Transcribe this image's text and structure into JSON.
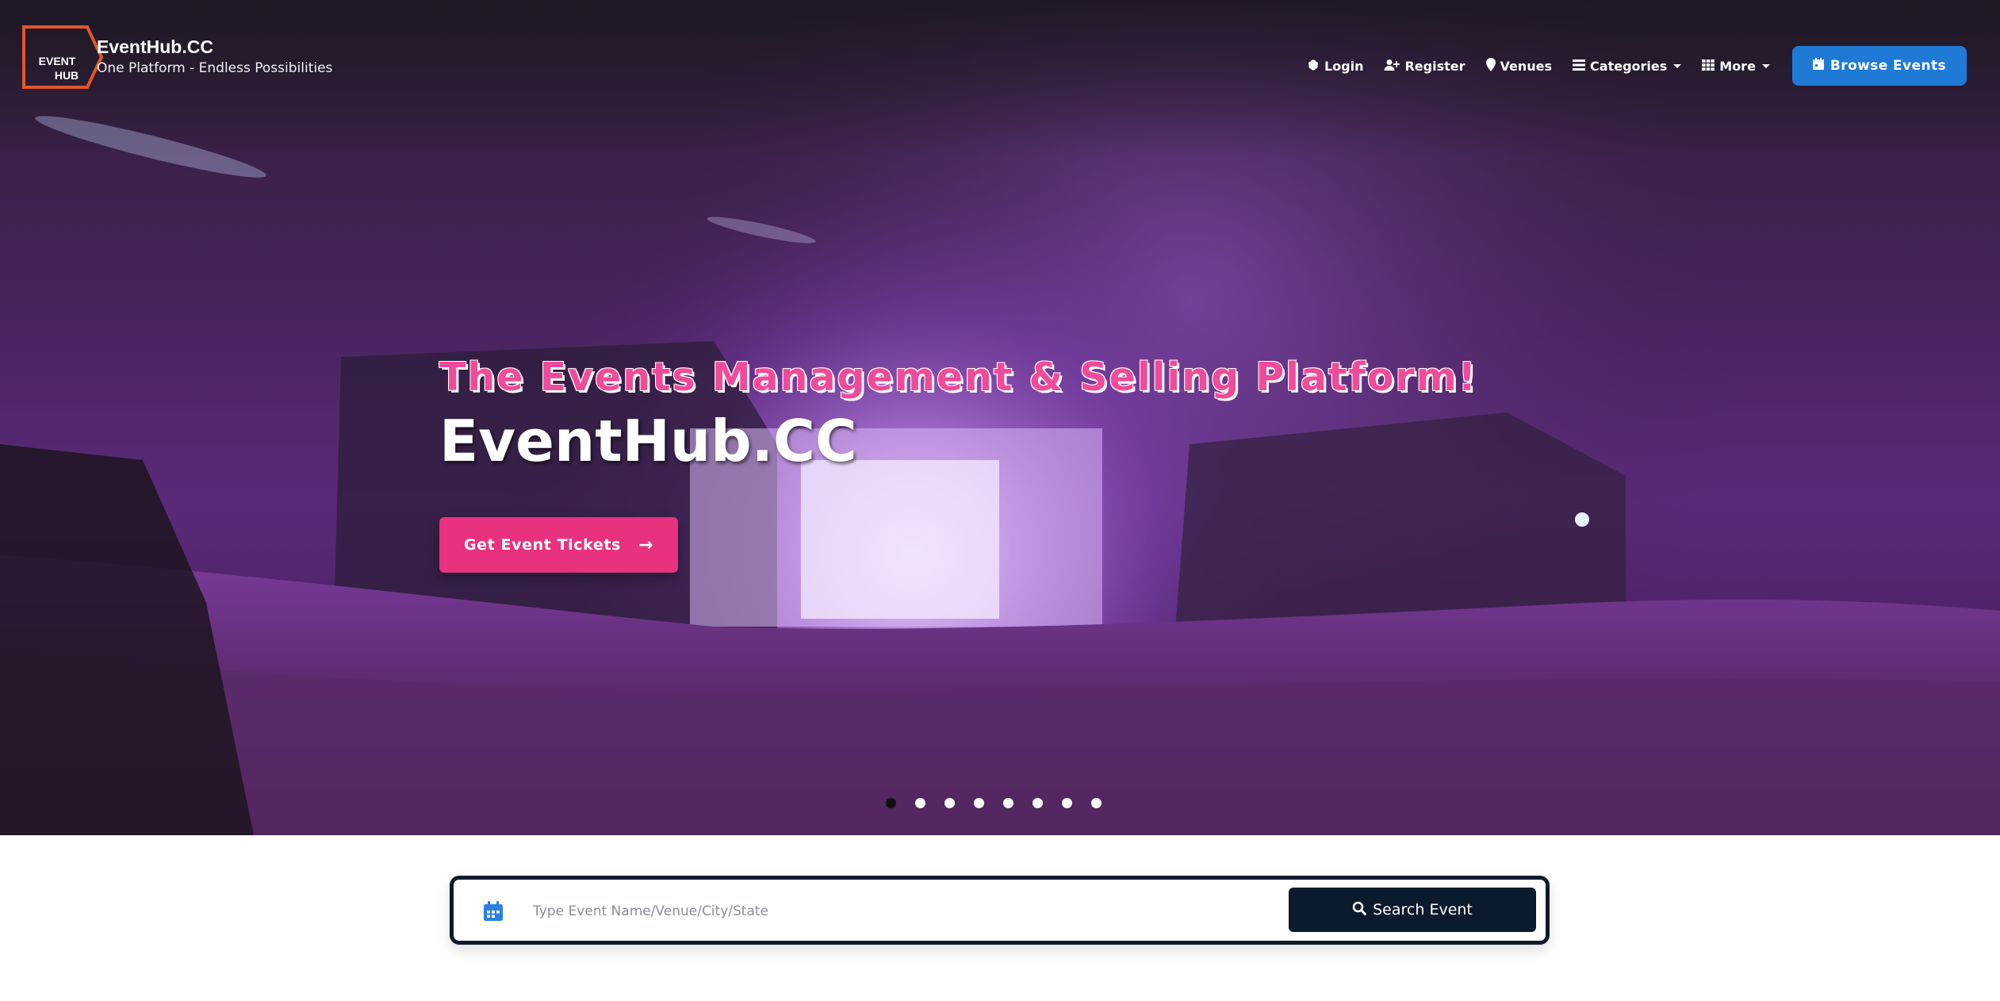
{
  "brand": {
    "logo_text_line1": "EVENT",
    "logo_text_line2": "HUB",
    "name": "EventHub.CC",
    "tagline": "One Platform - Endless Possibilities"
  },
  "nav": {
    "items": [
      {
        "label": "Login",
        "icon": "brain-icon"
      },
      {
        "label": "Register",
        "icon": "user-plus-icon"
      },
      {
        "label": "Venues",
        "icon": "map-marker-icon"
      },
      {
        "label": "Categories",
        "icon": "list-icon",
        "dropdown": true
      },
      {
        "label": "More",
        "icon": "grid-icon",
        "dropdown": true
      }
    ],
    "cta_label": "Browse Events",
    "cta_icon": "calendar-icon"
  },
  "hero": {
    "subtitle": "The Events Management & Selling Platform!",
    "title": "EventHub.CC",
    "button_label": "Get Event Tickets",
    "button_icon": "arrow-right-icon",
    "slides_count": 8,
    "active_slide": 1
  },
  "search": {
    "placeholder": "Type Event Name/Venue/City/State",
    "value": "",
    "button_label": "Search Event",
    "button_icon": "search-icon",
    "field_icon": "calendar-icon"
  },
  "colors": {
    "accent_blue": "#1f7ad6",
    "accent_pink": "#e8327f",
    "dark_navy": "#0b1a2c",
    "logo_orange": "#e0572a"
  }
}
